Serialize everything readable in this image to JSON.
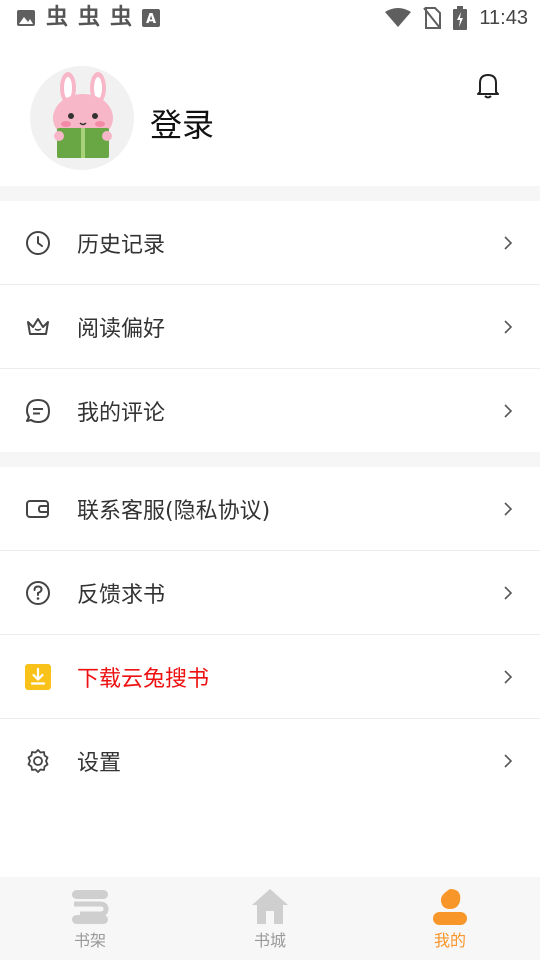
{
  "status_bar": {
    "time": "11:43",
    "notification_icons": [
      "image-icon",
      "bug-icon",
      "bug-icon",
      "bug-icon",
      "a-icon"
    ],
    "bug_glyph": "虫"
  },
  "profile": {
    "login_label": "登录"
  },
  "menu_group_1": [
    {
      "label": "历史记录",
      "icon": "clock-icon"
    },
    {
      "label": "阅读偏好",
      "icon": "crown-icon"
    },
    {
      "label": "我的评论",
      "icon": "comment-icon"
    }
  ],
  "menu_group_2": [
    {
      "label": "联系客服(隐私协议)",
      "icon": "wallet-icon"
    },
    {
      "label": "反馈求书",
      "icon": "help-icon"
    },
    {
      "label": "下载云兔搜书",
      "icon": "download-icon",
      "color": "#ee1111"
    },
    {
      "label": "设置",
      "icon": "settings-icon"
    }
  ],
  "bottom_nav": [
    {
      "label": "书架",
      "icon": "bookshelf-icon",
      "active": false
    },
    {
      "label": "书城",
      "icon": "home-icon",
      "active": false
    },
    {
      "label": "我的",
      "icon": "profile-icon",
      "active": true
    }
  ],
  "colors": {
    "accent": "#f8962a",
    "download_icon": "#f9c21a",
    "red_label": "#ee1111",
    "divider_bg": "#f6f6f6"
  }
}
